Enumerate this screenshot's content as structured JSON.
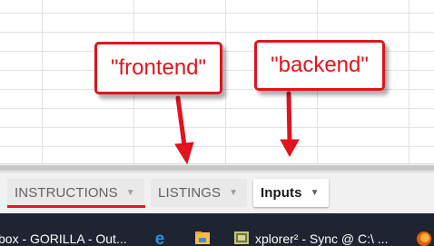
{
  "sheet_tabs": [
    {
      "label": "INSTRUCTIONS",
      "active": false
    },
    {
      "label": "LISTINGS",
      "active": false
    },
    {
      "label": "Inputs",
      "active": true
    }
  ],
  "annotations": {
    "frontend": "\"frontend\"",
    "backend": "\"backend\""
  },
  "taskbar": {
    "item1": "box - GORILLA - Out...",
    "item2": "xplorer² - Sync @ C:\\ ..."
  },
  "colors": {
    "annotation_red": "#e0141e",
    "taskbar_bg": "#1e2431",
    "tab_bar_bg": "#f1f1f1"
  },
  "icons": {
    "tab_menu": "caret-down-icon",
    "browser": "edge-icon",
    "folder": "file-explorer-icon",
    "app": "xplorer-icon",
    "firefox": "firefox-icon"
  }
}
